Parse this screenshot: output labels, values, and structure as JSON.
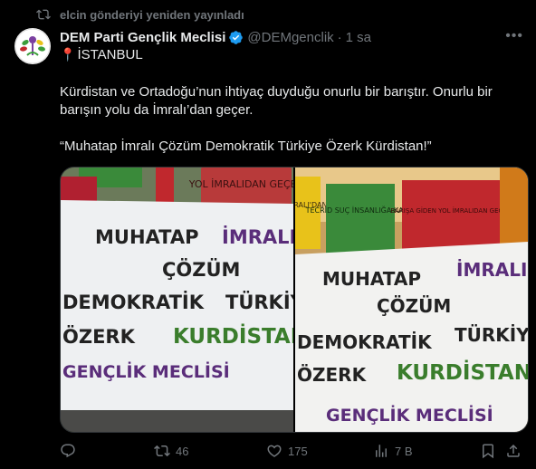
{
  "repost": {
    "text": "elcin gönderiyi yeniden yayınladı"
  },
  "tweet": {
    "author_name": "DEM Parti Gençlik Meclisi",
    "handle": "@DEMgenclik",
    "separator": "·",
    "time": "1 sa",
    "location": "İSTANBUL",
    "paragraph1": "Kürdistan ve Ortadoğu’nun ihtiyaç duyduğu onurlu bir barıştır. Onurlu bir barışın yolu da İmralı’dan geçer.",
    "paragraph2": "“Muhatap İmralı Çözüm Demokratik Türkiye Özerk Kürdistan!”"
  },
  "banner": {
    "line1a": "MUHATAP",
    "line1b": "İMRALI",
    "line2": "ÇÖZÜM",
    "line3a": "DEMOKRATİK",
    "line3b": "TÜRKİYE",
    "line4a": "ÖZERK",
    "line4b": "KURDİSTAN",
    "line5": "GENÇLİK MECLİSİ"
  },
  "signs": {
    "left_top": "YOL İMRALIDAN GEÇER",
    "right_yellow": "BARIŞ İMRALI'DAN GEÇER",
    "right_green": "TECRİD SUÇ İNSANLIĞA KARŞI",
    "right_red": "BARIŞA GİDEN YOL İMRALIDAN GEÇER"
  },
  "actions": {
    "replies": "",
    "reposts": "46",
    "likes": "175",
    "views": "7 B"
  },
  "colors": {
    "background": "#000000",
    "text": "#e7e9ea",
    "muted": "#71767b",
    "verified": "#1d9bf0",
    "pin": "#e0245e",
    "banner_green": "#3a7d2c",
    "banner_yellow": "#e8c21a",
    "banner_red": "#c0282d",
    "banner_purple": "#5a2d7a"
  },
  "icons": [
    "repost-icon",
    "verified-icon",
    "more-icon",
    "pin-icon",
    "reply-icon",
    "like-icon",
    "views-icon",
    "bookmark-icon",
    "share-icon"
  ]
}
